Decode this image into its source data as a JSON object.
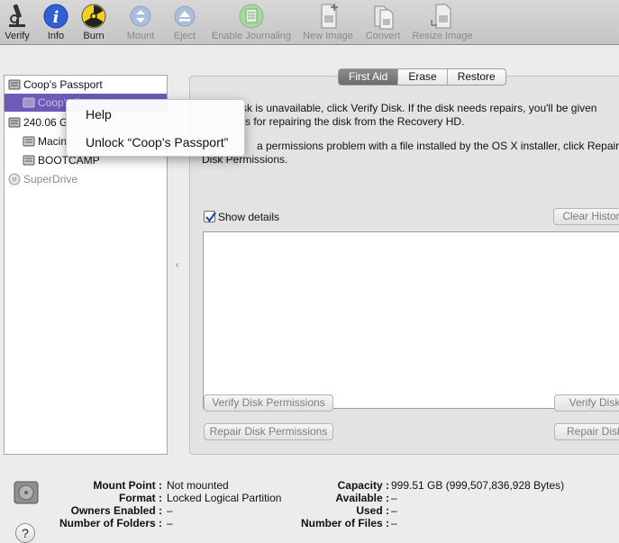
{
  "toolbar": {
    "verify": "Verify",
    "info": "Info",
    "burn": "Burn",
    "mount": "Mount",
    "eject": "Eject",
    "enable_journaling": "Enable Journaling",
    "new_image": "New Image",
    "convert": "Convert",
    "resize_image": "Resize Image"
  },
  "sidebar": {
    "items": [
      {
        "label": "Coop's Passport"
      },
      {
        "label": "Coop's Passport"
      },
      {
        "label": "240.06 G"
      },
      {
        "label": "Macin"
      },
      {
        "label": "BOOTCAMP"
      },
      {
        "label": "SuperDrive"
      }
    ]
  },
  "context_menu": {
    "help": "Help",
    "unlock": "Unlock “Coop's Passport”"
  },
  "tabs": {
    "first_aid": "First Aid",
    "erase": "Erase",
    "restore": "Restore"
  },
  "first_aid": {
    "line1": "sk is unavailable, click Verify Disk. If the disk needs repairs, you'll be given",
    "line2": "s for repairing the disk from the Recovery HD.",
    "line3": "a permissions problem with a file installed by the OS X installer, click Repair",
    "line4": "Disk Permissions.",
    "show_details": "Show details",
    "clear_history": "Clear History",
    "verify_permissions": "Verify Disk Permissions",
    "repair_permissions": "Repair Disk Permissions",
    "verify_disk": "Verify Disk",
    "repair_disk": "Repair Disk"
  },
  "info": {
    "mount_point_label": "Mount Point :",
    "mount_point": "Not mounted",
    "format_label": "Format :",
    "format": "Locked Logical Partition",
    "owners_label": "Owners Enabled :",
    "owners": "–",
    "folders_label": "Number of Folders :",
    "folders": "–",
    "capacity_label": "Capacity :",
    "capacity": "999.51 GB (999,507,836,928 Bytes)",
    "available_label": "Available :",
    "available": "–",
    "used_label": "Used :",
    "used": "–",
    "files_label": "Number of Files :",
    "files": "–"
  },
  "help_button": "?"
}
